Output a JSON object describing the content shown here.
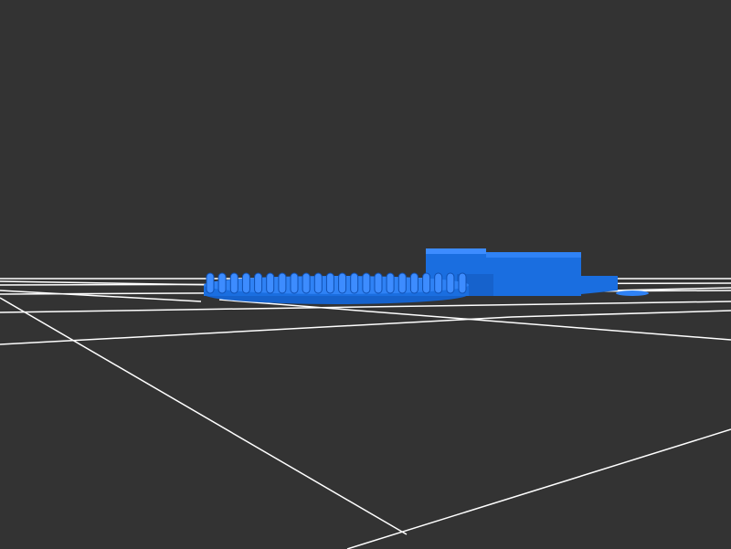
{
  "viewport": {
    "background_color": "#333333",
    "grid_color": "#ffffff",
    "model_color": "#1a6ee0",
    "model_shadow_color": "#0f4fb0",
    "model_highlight_color": "#3d8cff"
  },
  "scene": {
    "objects": [
      "ground-grid",
      "circular-toothed-base",
      "raised-block",
      "side-tab"
    ]
  }
}
